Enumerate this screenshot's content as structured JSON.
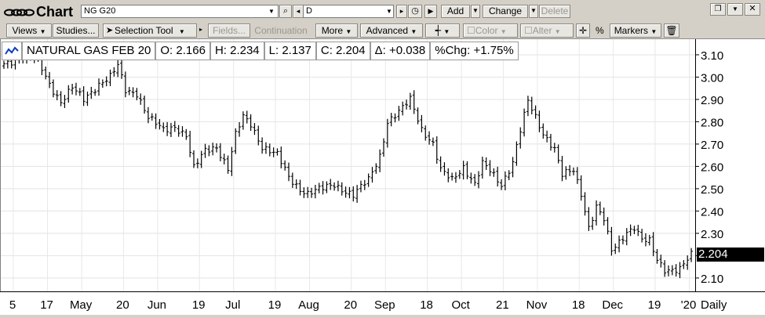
{
  "window": {
    "title": "Chart",
    "symbol_value": "NG G20",
    "period_value": "D",
    "add_label": "Add",
    "change_label": "Change",
    "delete_label": "Delete"
  },
  "toolbar": {
    "views_label": "Views",
    "studies_label": "Studies...",
    "selection_tool_label": "Selection Tool",
    "fields_label": "Fields...",
    "continuation_label": "Continuation",
    "more_label": "More",
    "advanced_label": "Advanced",
    "color_label": "Color",
    "alter_label": "Alter",
    "percent_label": "%",
    "markers_label": "Markers"
  },
  "quote": {
    "name": "NATURAL GAS FEB 20",
    "open": "O: 2.166",
    "high": "H: 2.234",
    "low": "L: 2.137",
    "close": "C: 2.204",
    "change": "Δ: +0.038",
    "pct_change": "%Chg: +1.75%"
  },
  "last_price": "2.204",
  "chart_data": {
    "type": "ohlc",
    "series_name": "NATURAL GAS FEB 20",
    "ylim": [
      2.04,
      3.17
    ],
    "y_ticks": [
      "3.10",
      "3.00",
      "2.90",
      "2.80",
      "2.70",
      "2.60",
      "2.50",
      "2.40",
      "2.30",
      "2.20",
      "2.10"
    ],
    "y_tick_values": [
      3.1,
      3.0,
      2.9,
      2.8,
      2.7,
      2.6,
      2.5,
      2.4,
      2.3,
      2.2,
      2.1
    ],
    "x_tick_labels": [
      "5",
      "17",
      "May",
      "20",
      "Jun",
      "19",
      "Jul",
      "19",
      "Aug",
      "20",
      "Sep",
      "18",
      "Oct",
      "21",
      "Nov",
      "18",
      "Dec",
      "19",
      "'20",
      "Daily"
    ],
    "x_tick_positions": [
      0,
      9,
      18,
      29,
      38,
      49,
      58,
      69,
      78,
      89,
      98,
      109,
      118,
      129,
      138,
      149,
      158,
      169,
      178,
      186
    ],
    "n_bars": 182,
    "anchors": [
      [
        0,
        3.06
      ],
      [
        6,
        3.1
      ],
      [
        9,
        3.07
      ],
      [
        12,
        2.97
      ],
      [
        15,
        2.89
      ],
      [
        18,
        2.95
      ],
      [
        21,
        2.9
      ],
      [
        25,
        2.97
      ],
      [
        28,
        3.0
      ],
      [
        30,
        3.05
      ],
      [
        32,
        2.94
      ],
      [
        35,
        2.93
      ],
      [
        38,
        2.82
      ],
      [
        42,
        2.76
      ],
      [
        45,
        2.78
      ],
      [
        48,
        2.74
      ],
      [
        50,
        2.59
      ],
      [
        53,
        2.67
      ],
      [
        56,
        2.69
      ],
      [
        59,
        2.59
      ],
      [
        61,
        2.74
      ],
      [
        63,
        2.82
      ],
      [
        65,
        2.79
      ],
      [
        68,
        2.69
      ],
      [
        72,
        2.65
      ],
      [
        75,
        2.55
      ],
      [
        78,
        2.5
      ],
      [
        80,
        2.48
      ],
      [
        84,
        2.5
      ],
      [
        87,
        2.52
      ],
      [
        89,
        2.5
      ],
      [
        92,
        2.47
      ],
      [
        96,
        2.54
      ],
      [
        99,
        2.65
      ],
      [
        101,
        2.8
      ],
      [
        104,
        2.84
      ],
      [
        107,
        2.9
      ],
      [
        108,
        2.86
      ],
      [
        110,
        2.77
      ],
      [
        113,
        2.7
      ],
      [
        115,
        2.58
      ],
      [
        118,
        2.54
      ],
      [
        121,
        2.6
      ],
      [
        124,
        2.52
      ],
      [
        126,
        2.61
      ],
      [
        128,
        2.58
      ],
      [
        131,
        2.52
      ],
      [
        134,
        2.62
      ],
      [
        136,
        2.76
      ],
      [
        138,
        2.89
      ],
      [
        140,
        2.82
      ],
      [
        142,
        2.75
      ],
      [
        145,
        2.68
      ],
      [
        147,
        2.56
      ],
      [
        150,
        2.58
      ],
      [
        152,
        2.48
      ],
      [
        154,
        2.33
      ],
      [
        156,
        2.42
      ],
      [
        158,
        2.36
      ],
      [
        160,
        2.22
      ],
      [
        162,
        2.26
      ],
      [
        164,
        2.31
      ],
      [
        166,
        2.33
      ],
      [
        168,
        2.27
      ],
      [
        170,
        2.26
      ],
      [
        172,
        2.18
      ],
      [
        174,
        2.14
      ],
      [
        176,
        2.14
      ],
      [
        178,
        2.14
      ],
      [
        181,
        2.2
      ]
    ],
    "grid": true
  }
}
